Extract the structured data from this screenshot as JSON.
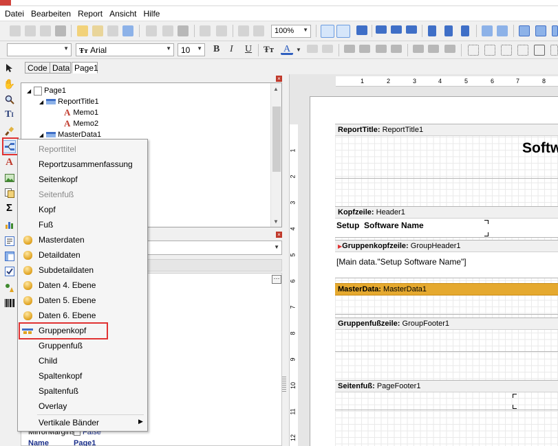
{
  "menu": {
    "items": [
      "Datei",
      "Bearbeiten",
      "Report",
      "Ansicht",
      "Hilfe"
    ]
  },
  "toolbar": {
    "zoom": "100%",
    "font_name": "Arial",
    "font_size": "10",
    "bold": "B",
    "italic": "I",
    "underline": "U"
  },
  "tabs": [
    "Code",
    "Data",
    "Page1"
  ],
  "tree": {
    "nodes": [
      "Page1",
      "ReportTitle1",
      "Memo1",
      "Memo2",
      "MasterData1"
    ]
  },
  "context_menu": {
    "items": [
      "Reporttitel",
      "Reportzusammenfassung",
      "Seitenkopf",
      "Seitenfuß",
      "Kopf",
      "Fuß",
      "Masterdaten",
      "Detaildaten",
      "Subdetaildaten",
      "Daten 4. Ebene",
      "Daten 5. Ebene",
      "Daten 6. Ebene",
      "Gruppenkopf",
      "Gruppenfuß",
      "Child",
      "Spaltenkopf",
      "Spaltenfuß",
      "Overlay",
      "Vertikale Bänder"
    ],
    "highlighted": "Gruppenkopf"
  },
  "properties": {
    "mirror_label": "MirrorMargins",
    "mirror_value": "False",
    "name_label": "Name",
    "name_value": "Page1"
  },
  "ruler": {
    "h_ticks": [
      "1",
      "2",
      "3",
      "4",
      "5",
      "6",
      "7",
      "8"
    ],
    "v_ticks": [
      "1",
      "2",
      "3",
      "4",
      "5",
      "6",
      "7",
      "8",
      "9",
      "10",
      "11",
      "12"
    ]
  },
  "bands": {
    "report_title": {
      "kind": "ReportTitle:",
      "name": "ReportTitle1",
      "content": "Softw"
    },
    "header": {
      "kind": "Kopfzeile:",
      "name": "Header1",
      "content": "Setup  Software Name"
    },
    "group_header": {
      "kind": "Gruppenkopfzeile:",
      "name": "GroupHeader1",
      "content": "[Main data.\"Setup Software Name\"]"
    },
    "master_data": {
      "kind": "MasterData:",
      "name": "MasterData1"
    },
    "group_footer": {
      "kind": "Gruppenfußzeile:",
      "name": "GroupFooter1"
    },
    "page_footer": {
      "kind": "Seitenfuß:",
      "name": "PageFooter1"
    }
  },
  "colors": {
    "master_band": "#e5a92f",
    "highlight_border": "#e03131"
  }
}
